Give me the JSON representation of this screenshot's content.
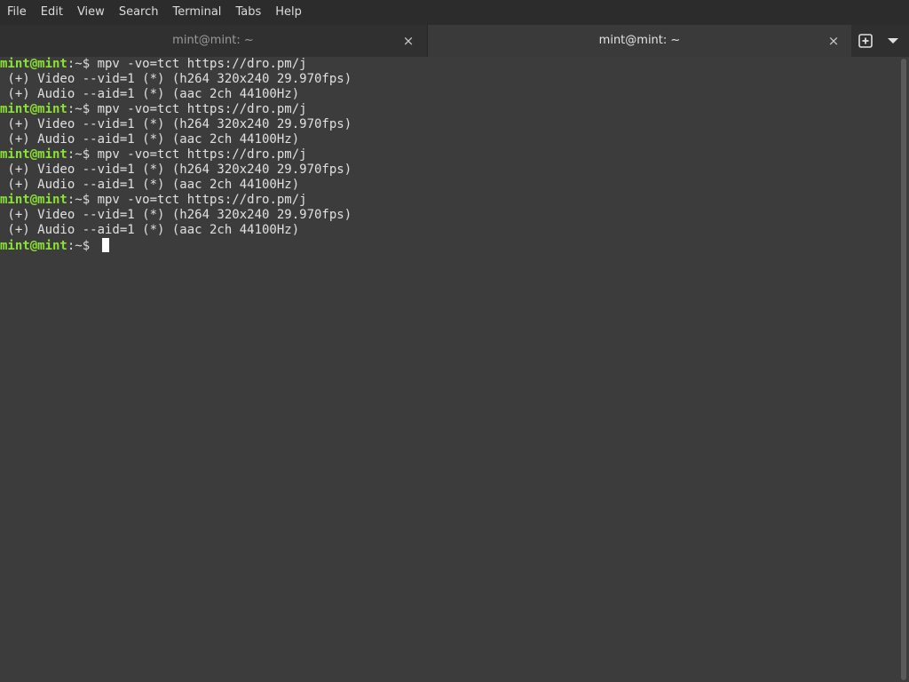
{
  "menubar": {
    "items": [
      "File",
      "Edit",
      "View",
      "Search",
      "Terminal",
      "Tabs",
      "Help"
    ]
  },
  "tabs": [
    {
      "label": "mint@mint: ~",
      "active": false,
      "close": "×"
    },
    {
      "label": "mint@mint: ~",
      "active": true,
      "close": "×"
    }
  ],
  "tab_actions": {
    "new_tab_icon": "plus-square-icon",
    "menu_icon": "dropdown-triangle-icon"
  },
  "terminal": {
    "prompt_user": "mint@mint",
    "prompt_path": ":~$ ",
    "lines": [
      {
        "type": "prompt",
        "command": "mpv -vo=tct https://dro.pm/j"
      },
      {
        "type": "output",
        "text": " (+) Video --vid=1 (*) (h264 320x240 29.970fps)"
      },
      {
        "type": "output",
        "text": " (+) Audio --aid=1 (*) (aac 2ch 44100Hz)"
      },
      {
        "type": "prompt",
        "command": "mpv -vo=tct https://dro.pm/j"
      },
      {
        "type": "output",
        "text": " (+) Video --vid=1 (*) (h264 320x240 29.970fps)"
      },
      {
        "type": "output",
        "text": " (+) Audio --aid=1 (*) (aac 2ch 44100Hz)"
      },
      {
        "type": "prompt",
        "command": "mpv -vo=tct https://dro.pm/j"
      },
      {
        "type": "output",
        "text": " (+) Video --vid=1 (*) (h264 320x240 29.970fps)"
      },
      {
        "type": "output",
        "text": " (+) Audio --aid=1 (*) (aac 2ch 44100Hz)"
      },
      {
        "type": "prompt",
        "command": "mpv -vo=tct https://dro.pm/j"
      },
      {
        "type": "output",
        "text": " (+) Video --vid=1 (*) (h264 320x240 29.970fps)"
      },
      {
        "type": "output",
        "text": " (+) Audio --aid=1 (*) (aac 2ch 44100Hz)"
      },
      {
        "type": "prompt",
        "command": "",
        "cursor": true
      }
    ]
  },
  "colors": {
    "prompt_user": "#8ae234",
    "background": "#3c3c3c",
    "menubar": "#2c2c2c"
  }
}
